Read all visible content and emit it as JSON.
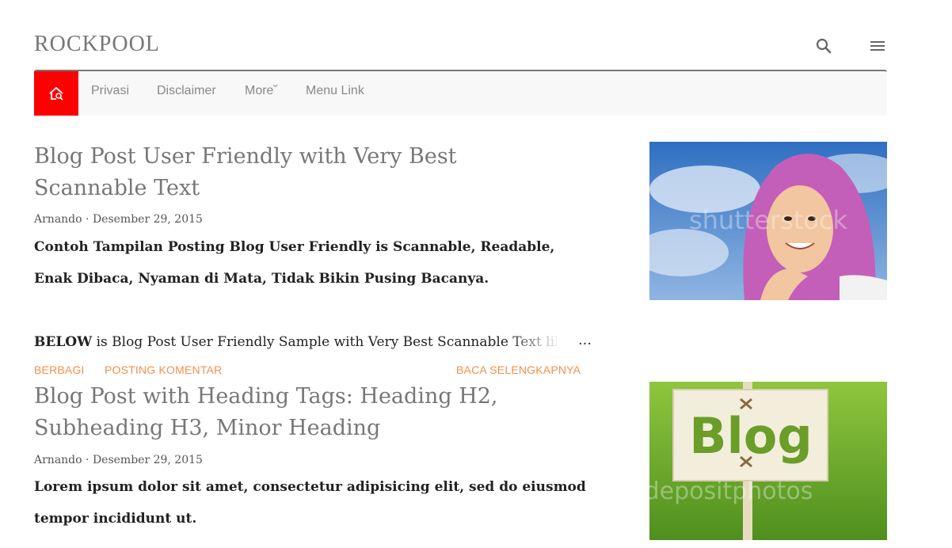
{
  "header": {
    "site_title": "ROCKPOOL",
    "search_icon": "search-icon",
    "menu_icon": "hamburger-menu-icon"
  },
  "nav": {
    "home_icon": "home-search-icon",
    "items": [
      "Privasi",
      "Disclaimer",
      "More˘",
      "Menu Link"
    ]
  },
  "posts": [
    {
      "title": "Blog Post User Friendly with Very Best Scannable Text",
      "author": "Arnando",
      "date": "Desember 29, 2015",
      "snippet": "Contoh Tampilan Posting Blog User Friendly is Scannable, Readable, Enak Dibaca, Nyaman di Mata, Tidak Bikin Pusing Bacanya.",
      "body_bold": "BELOW",
      "body_rest": " is Blog Post User Friendly Sample with Very Best Scannable Text like",
      "ellipsis": "…",
      "actions": {
        "share": "BERBAGI",
        "comment": "POSTING KOMENTAR",
        "read_more": "BACA SELENGKAPNYA"
      },
      "thumb_watermark": "shutterstock"
    },
    {
      "title": "Blog Post with Heading Tags: Heading H2, Subheading H3, Minor Heading",
      "author": "Arnando",
      "date": "Desember 29, 2015",
      "snippet": "Lorem ipsum dolor sit amet, consectetur adipisicing elit, sed do eiusmod tempor incididunt ut.",
      "thumb_sign": "Blog",
      "thumb_watermark": "depositphotos"
    }
  ],
  "colors": {
    "accent": "#ff0000",
    "action": "#f0914a",
    "title": "#777777"
  }
}
